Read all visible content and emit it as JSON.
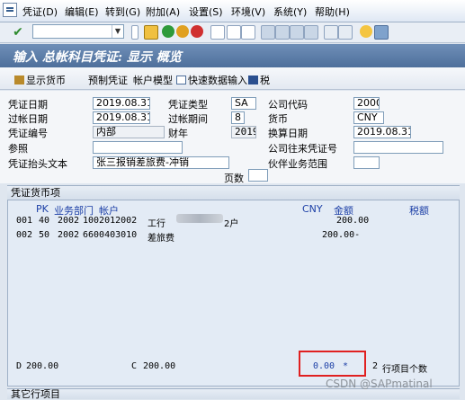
{
  "menubar": {
    "items": [
      "凭证(D)",
      "编辑(E)",
      "转到(G)",
      "附加(A)",
      "设置(S)",
      "环境(V)",
      "系统(Y)",
      "帮助(H)"
    ]
  },
  "toolbar": {
    "command_value": ""
  },
  "window": {
    "title": "输入 总帐科目凭证: 显示 概览"
  },
  "app_toolbar": {
    "display_currency": "显示货币",
    "park_document": "预制凭证",
    "account_model": "帐户模型",
    "fast_entry": "快速数据输入",
    "tax": "税"
  },
  "header": {
    "doc_date_label": "凭证日期",
    "doc_date": "2019.08.31",
    "doc_type_label": "凭证类型",
    "doc_type": "SA",
    "company_code_label": "公司代码",
    "company_code": "2000",
    "posting_date_label": "过帐日期",
    "posting_date": "2019.08.31",
    "period_label": "过帐期间",
    "period": "8",
    "currency_label": "货币",
    "currency": "CNY",
    "doc_number_label": "凭证编号",
    "doc_number": "内部",
    "fiscal_year_label": "财年",
    "fiscal_year": "2019",
    "translation_date_label": "换算日期",
    "translation_date": "2019.08.31",
    "reference_label": "参照",
    "reference": "",
    "intercompany_label": "公司往来凭证号",
    "intercompany": "",
    "header_text_label": "凭证抬头文本",
    "header_text": "张三报销差旅费-冲销",
    "trading_partner_label": "伙伴业务范围",
    "trading_partner": "",
    "pages_label": "页数",
    "pages": ""
  },
  "items_section": {
    "title": "凭证货币项",
    "col_pk": "PK",
    "col_bus": "业务部门",
    "col_account": "帐户",
    "col_cny": "CNY",
    "col_amount": "金额",
    "col_tax": "税额",
    "rows": [
      {
        "line": "001",
        "pk": "40",
        "bus_area": "2002",
        "account": "1002012002",
        "text": "工行",
        "text_tail": "2户",
        "amount": "200.00"
      },
      {
        "line": "002",
        "pk": "50",
        "bus_area": "2002",
        "account": "6600403010",
        "text": "差旅费",
        "text_tail": "",
        "amount": "200.00-"
      }
    ],
    "debit_label": "D",
    "debit_total": "200.00",
    "credit_label": "C",
    "credit_total": "200.00",
    "balance": "0.00",
    "balance_status": "*",
    "item_count": "2",
    "item_count_label": "行项目个数"
  },
  "other_section": {
    "title": "其它行项目"
  },
  "watermark": "CSDN @SAPmatinal",
  "colors": {
    "title_bar": "#4e6f9b",
    "highlight_box": "#e02020",
    "column_header": "#1c3fa6"
  }
}
